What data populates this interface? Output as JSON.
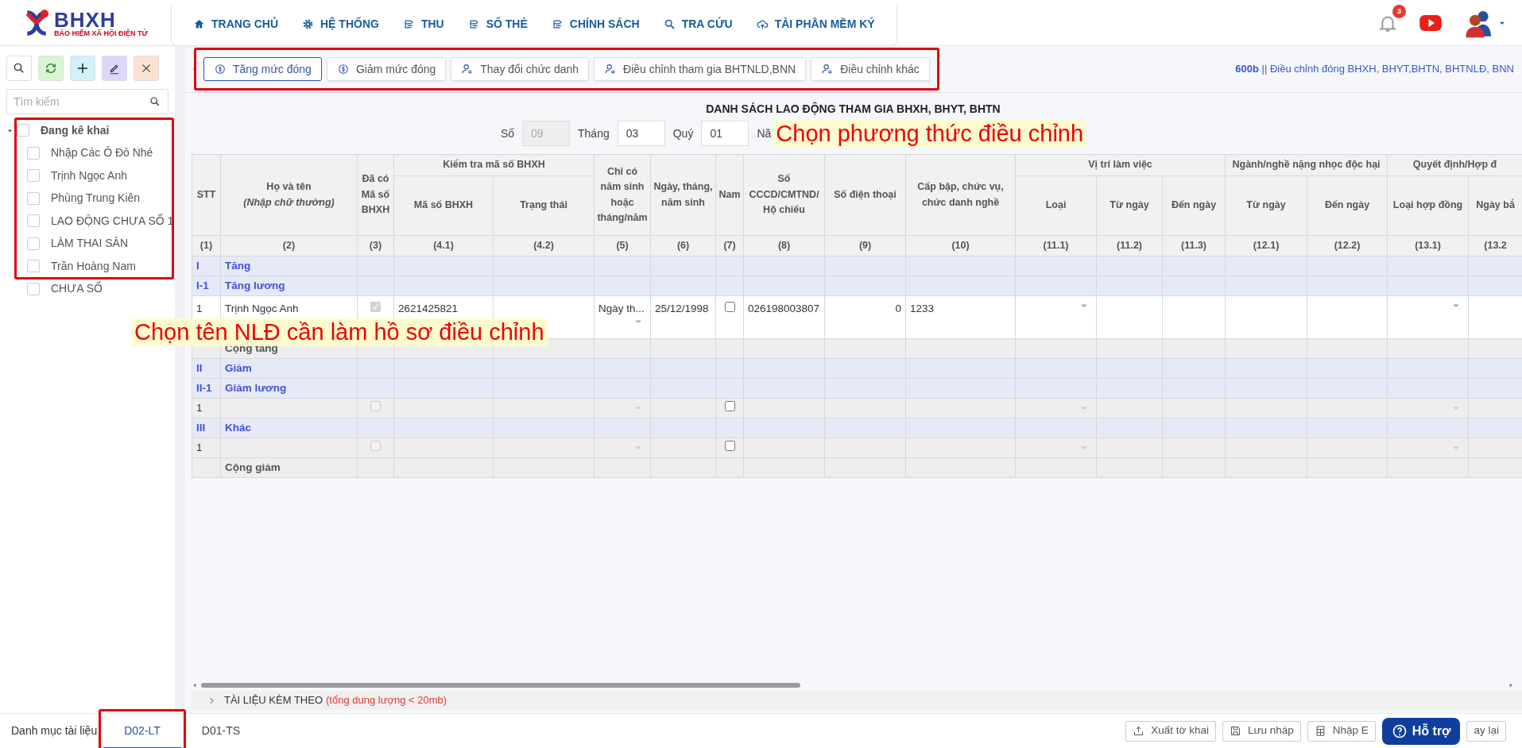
{
  "logo": {
    "name": "BHXH",
    "tagline": "BẢO HIỂM XÃ HỘI ĐIỆN TỬ"
  },
  "nav": [
    {
      "label": "TRANG CHỦ",
      "kind": "home"
    },
    {
      "label": "HỆ THỐNG",
      "kind": "gear"
    },
    {
      "label": "THU",
      "kind": "doc"
    },
    {
      "label": "SỐ THẺ",
      "kind": "doc"
    },
    {
      "label": "CHÍNH SÁCH",
      "kind": "doc"
    },
    {
      "label": "TRA CỨU",
      "kind": "search"
    },
    {
      "label": "TẢI PHẦN MỀM KÝ",
      "kind": "cloud"
    }
  ],
  "notifications": {
    "count": "3"
  },
  "sidebar": {
    "tools": [
      {
        "kind": "search"
      },
      {
        "kind": "refresh"
      },
      {
        "kind": "add"
      },
      {
        "kind": "edit"
      },
      {
        "kind": "delete"
      }
    ],
    "search": {
      "placeholder": "Tìm kiếm"
    },
    "tree": {
      "label": "Đang kê khai",
      "highlighted": true,
      "expanded": true,
      "checked": false,
      "children": [
        {
          "label": "Nhập Các Ô Đỏ Nhé",
          "checked": false
        },
        {
          "label": "Trịnh Ngọc Anh",
          "checked": false
        },
        {
          "label": "Phùng Trung Kiên",
          "checked": false
        },
        {
          "label": "LAO ĐỘNG CHƯA SỐ 1",
          "checked": false
        },
        {
          "label": "LÀM THAI SẢN",
          "checked": false
        },
        {
          "label": "Trần Hoàng Nam",
          "checked": false
        },
        {
          "label": "CHƯA SỐ",
          "checked": false
        }
      ]
    }
  },
  "toolbar": {
    "highlighted": true,
    "buttons": [
      {
        "label": "Tăng mức đóng",
        "kind": "coin",
        "selected": true
      },
      {
        "label": "Giảm mức đóng",
        "kind": "coin",
        "selected": false
      },
      {
        "label": "Thay đổi chức danh",
        "kind": "user",
        "selected": false
      },
      {
        "label": "Điều chỉnh tham gia BHTNLD,BNN",
        "kind": "user",
        "selected": false
      },
      {
        "label": "Điều chỉnh khác",
        "kind": "user",
        "selected": false
      }
    ],
    "form_code": "**600b** || Điều chỉnh đóng BHXH, BHYT,BHTN, BHTNLĐ, BNN"
  },
  "form": {
    "title": "DANH SÁCH LAO ĐỘNG THAM GIA BHXH, BHYT, BHTN",
    "fields": [
      {
        "label": "Số",
        "value": "09",
        "disabled": true
      },
      {
        "label": "Tháng",
        "value": "03",
        "disabled": false
      },
      {
        "label": "Quý",
        "value": "01",
        "disabled": false
      },
      {
        "label": "Nă"
      }
    ],
    "callout": "Chọn phương thức điều chỉnh"
  },
  "table": {
    "columns": [
      {
        "label": "STT",
        "number": "(1)"
      },
      {
        "label": "Họ và tên",
        "note": "(Nhập chữ thường)",
        "number": "(2)"
      },
      {
        "label": "Đã có Mã số BHXH",
        "number": "(3)"
      },
      {
        "group": "Kiểm tra mã số BHXH",
        "columns": [
          {
            "label": "Mã số BHXH",
            "number": "(4.1)"
          },
          {
            "label": "Trạng thái",
            "number": "(4.2)"
          }
        ]
      },
      {
        "label": "Chỉ có năm sinh hoặc tháng/năm",
        "number": "(5)"
      },
      {
        "label": "Ngày, tháng, năm sinh",
        "number": "(6)"
      },
      {
        "label": "Nam",
        "number": "(7)"
      },
      {
        "label": "Số CCCD/CMTND/ Hộ chiếu",
        "number": "(8)"
      },
      {
        "label": "Số điện thoại",
        "number": "(9)"
      },
      {
        "label": "Cấp bập, chức vụ, chức danh nghề",
        "number": "(10)"
      },
      {
        "group": "Vị trí làm việc",
        "columns": [
          {
            "label": "Loại",
            "number": "(11.1)"
          },
          {
            "label": "Từ ngày",
            "number": "(11.2)"
          },
          {
            "label": "Đến ngày",
            "number": "(11.3)"
          }
        ]
      },
      {
        "group": "Ngành/nghề nặng nhọc độc hại",
        "columns": [
          {
            "label": "Từ ngày",
            "number": "(12.1)"
          },
          {
            "label": "Đến ngày",
            "number": "(12.2)"
          }
        ]
      },
      {
        "group": "Quyết định/Hợp đ",
        "columns": [
          {
            "label": "Loại hợp đồng",
            "number": "(13.1)"
          },
          {
            "label": "Ngày bắ",
            "number": "(13.2"
          }
        ]
      }
    ],
    "rows": [
      {
        "kind": "section",
        "code": "I",
        "label": "Tăng"
      },
      {
        "kind": "section",
        "code": "I-1",
        "label": "Tăng lương"
      },
      {
        "kind": "entry",
        "editable": true,
        "stt": "1",
        "name": "Trịnh Ngọc Anh",
        "has_code": true,
        "code": "2621425821",
        "birth_type": "Ngày th...",
        "dob": "25/12/1998",
        "male": false,
        "id_number": "026198003807",
        "phone": "0",
        "rank": "1233"
      },
      {
        "kind": "total",
        "label": "Cộng tăng"
      },
      {
        "kind": "section",
        "code": "II",
        "label": "Giảm"
      },
      {
        "kind": "section",
        "code": "II-1",
        "label": "Giảm lương"
      },
      {
        "kind": "entry",
        "editable": false,
        "stt": "1",
        "has_code": false,
        "male": false
      },
      {
        "kind": "section",
        "code": "III",
        "label": "Khác"
      },
      {
        "kind": "entry",
        "editable": false,
        "stt": "1",
        "has_code": false,
        "male": false
      },
      {
        "kind": "total",
        "label": "Cộng giảm"
      }
    ],
    "callout": "Chọn tên NLĐ cần làm hồ sơ điều chỉnh"
  },
  "attachments": {
    "title": "TÀI LIỆU KÈM THEO",
    "note": "(tổng dung lượng < 20mb)",
    "expanded": false
  },
  "bottom": {
    "label": "Danh mục tài liệu",
    "tabs": [
      {
        "label": "D02-LT",
        "selected": true,
        "highlighted": true
      },
      {
        "label": "D01-TS",
        "selected": false,
        "highlighted": false
      }
    ],
    "buttons": [
      {
        "label": "Xuất tờ khai",
        "kind": "export"
      },
      {
        "label": "Lưu nháp",
        "kind": "save"
      },
      {
        "label": "Nhập E",
        "kind": "sheet"
      },
      {
        "label": "Hỗ trợ",
        "kind": "help"
      },
      {
        "label": "ay lại",
        "kind": "plain"
      }
    ]
  }
}
